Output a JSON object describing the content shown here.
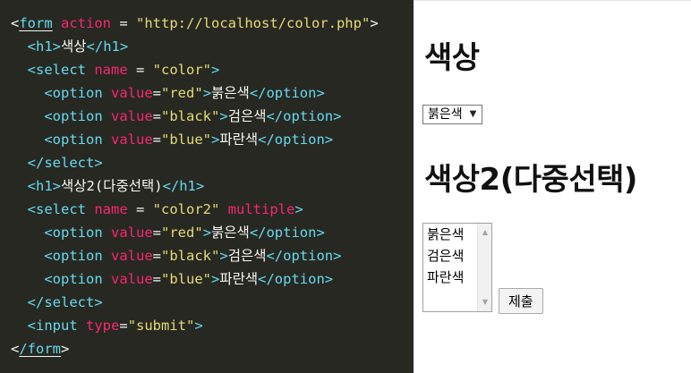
{
  "editor": {
    "lines": [
      [
        {
          "t": "<",
          "c": "pun"
        },
        {
          "t": "form",
          "c": "tag-u"
        },
        {
          "t": " ",
          "c": "pun"
        },
        {
          "t": "action",
          "c": "attr"
        },
        {
          "t": " = ",
          "c": "pun"
        },
        {
          "t": "\"http://localhost/color.php\"",
          "c": "str"
        },
        {
          "t": ">",
          "c": "pun"
        }
      ],
      [
        {
          "t": "  ",
          "c": "pun"
        },
        {
          "t": "<h1>",
          "c": "tag"
        },
        {
          "t": "색상",
          "c": "txt"
        },
        {
          "t": "</h1>",
          "c": "tag"
        }
      ],
      [
        {
          "t": "  ",
          "c": "pun"
        },
        {
          "t": "<select",
          "c": "tag"
        },
        {
          "t": " ",
          "c": "pun"
        },
        {
          "t": "name",
          "c": "attr"
        },
        {
          "t": " = ",
          "c": "pun"
        },
        {
          "t": "\"color\"",
          "c": "str"
        },
        {
          "t": ">",
          "c": "tag"
        }
      ],
      [
        {
          "t": "    ",
          "c": "pun"
        },
        {
          "t": "<option",
          "c": "tag"
        },
        {
          "t": " ",
          "c": "pun"
        },
        {
          "t": "value",
          "c": "attr"
        },
        {
          "t": "=",
          "c": "pun"
        },
        {
          "t": "\"red\"",
          "c": "str"
        },
        {
          "t": ">",
          "c": "tag"
        },
        {
          "t": "붉은색",
          "c": "txt"
        },
        {
          "t": "</option>",
          "c": "tag"
        }
      ],
      [
        {
          "t": "    ",
          "c": "pun"
        },
        {
          "t": "<option",
          "c": "tag"
        },
        {
          "t": " ",
          "c": "pun"
        },
        {
          "t": "value",
          "c": "attr"
        },
        {
          "t": "=",
          "c": "pun"
        },
        {
          "t": "\"black\"",
          "c": "str"
        },
        {
          "t": ">",
          "c": "tag"
        },
        {
          "t": "검은색",
          "c": "txt"
        },
        {
          "t": "</option>",
          "c": "tag"
        }
      ],
      [
        {
          "t": "    ",
          "c": "pun"
        },
        {
          "t": "<option",
          "c": "tag"
        },
        {
          "t": " ",
          "c": "pun"
        },
        {
          "t": "value",
          "c": "attr"
        },
        {
          "t": "=",
          "c": "pun"
        },
        {
          "t": "\"blue\"",
          "c": "str"
        },
        {
          "t": ">",
          "c": "tag"
        },
        {
          "t": "파란색",
          "c": "txt"
        },
        {
          "t": "</option>",
          "c": "tag"
        }
      ],
      [
        {
          "t": "  ",
          "c": "pun"
        },
        {
          "t": "</select>",
          "c": "tag"
        }
      ],
      [
        {
          "t": "  ",
          "c": "pun"
        },
        {
          "t": "<h1>",
          "c": "tag"
        },
        {
          "t": "색상2(다중선택)",
          "c": "txt"
        },
        {
          "t": "</h1>",
          "c": "tag"
        }
      ],
      [
        {
          "t": "  ",
          "c": "pun"
        },
        {
          "t": "<select",
          "c": "tag"
        },
        {
          "t": " ",
          "c": "pun"
        },
        {
          "t": "name",
          "c": "attr"
        },
        {
          "t": " = ",
          "c": "pun"
        },
        {
          "t": "\"color2\"",
          "c": "str"
        },
        {
          "t": " ",
          "c": "pun"
        },
        {
          "t": "multiple",
          "c": "attr"
        },
        {
          "t": ">",
          "c": "tag"
        }
      ],
      [
        {
          "t": "    ",
          "c": "pun"
        },
        {
          "t": "<option",
          "c": "tag"
        },
        {
          "t": " ",
          "c": "pun"
        },
        {
          "t": "value",
          "c": "attr"
        },
        {
          "t": "=",
          "c": "pun"
        },
        {
          "t": "\"red\"",
          "c": "str"
        },
        {
          "t": ">",
          "c": "tag"
        },
        {
          "t": "붉은색",
          "c": "txt"
        },
        {
          "t": "</option>",
          "c": "tag"
        }
      ],
      [
        {
          "t": "    ",
          "c": "pun"
        },
        {
          "t": "<option",
          "c": "tag"
        },
        {
          "t": " ",
          "c": "pun"
        },
        {
          "t": "value",
          "c": "attr"
        },
        {
          "t": "=",
          "c": "pun"
        },
        {
          "t": "\"black\"",
          "c": "str"
        },
        {
          "t": ">",
          "c": "tag"
        },
        {
          "t": "검은색",
          "c": "txt"
        },
        {
          "t": "</option>",
          "c": "tag"
        }
      ],
      [
        {
          "t": "    ",
          "c": "pun"
        },
        {
          "t": "<option",
          "c": "tag"
        },
        {
          "t": " ",
          "c": "pun"
        },
        {
          "t": "value",
          "c": "attr"
        },
        {
          "t": "=",
          "c": "pun"
        },
        {
          "t": "\"blue\"",
          "c": "str"
        },
        {
          "t": ">",
          "c": "tag"
        },
        {
          "t": "파란색",
          "c": "txt"
        },
        {
          "t": "</option>",
          "c": "tag"
        }
      ],
      [
        {
          "t": "  ",
          "c": "pun"
        },
        {
          "t": "</select>",
          "c": "tag"
        }
      ],
      [
        {
          "t": "  ",
          "c": "pun"
        },
        {
          "t": "<input",
          "c": "tag"
        },
        {
          "t": " ",
          "c": "pun"
        },
        {
          "t": "type",
          "c": "attr"
        },
        {
          "t": "=",
          "c": "pun"
        },
        {
          "t": "\"submit\"",
          "c": "str"
        },
        {
          "t": ">",
          "c": "tag"
        }
      ],
      [
        {
          "t": "<",
          "c": "pun"
        },
        {
          "t": "/form",
          "c": "tag-u"
        },
        {
          "t": ">",
          "c": "pun"
        }
      ]
    ],
    "colors": {
      "background": "#272822",
      "tag": "#66d9ef",
      "attribute": "#f92672",
      "string": "#e6db74",
      "text": "#f8f8f2"
    }
  },
  "preview": {
    "heading1": "색상",
    "select_single": {
      "selected": "붉은색",
      "arrow_icon": "▼"
    },
    "heading2": "색상2(다중선택)",
    "select_multiple": {
      "options": [
        "붉은색",
        "검은색",
        "파란색"
      ],
      "scroll_up_icon": "▲",
      "scroll_down_icon": "▼"
    },
    "submit_label": "제출"
  }
}
